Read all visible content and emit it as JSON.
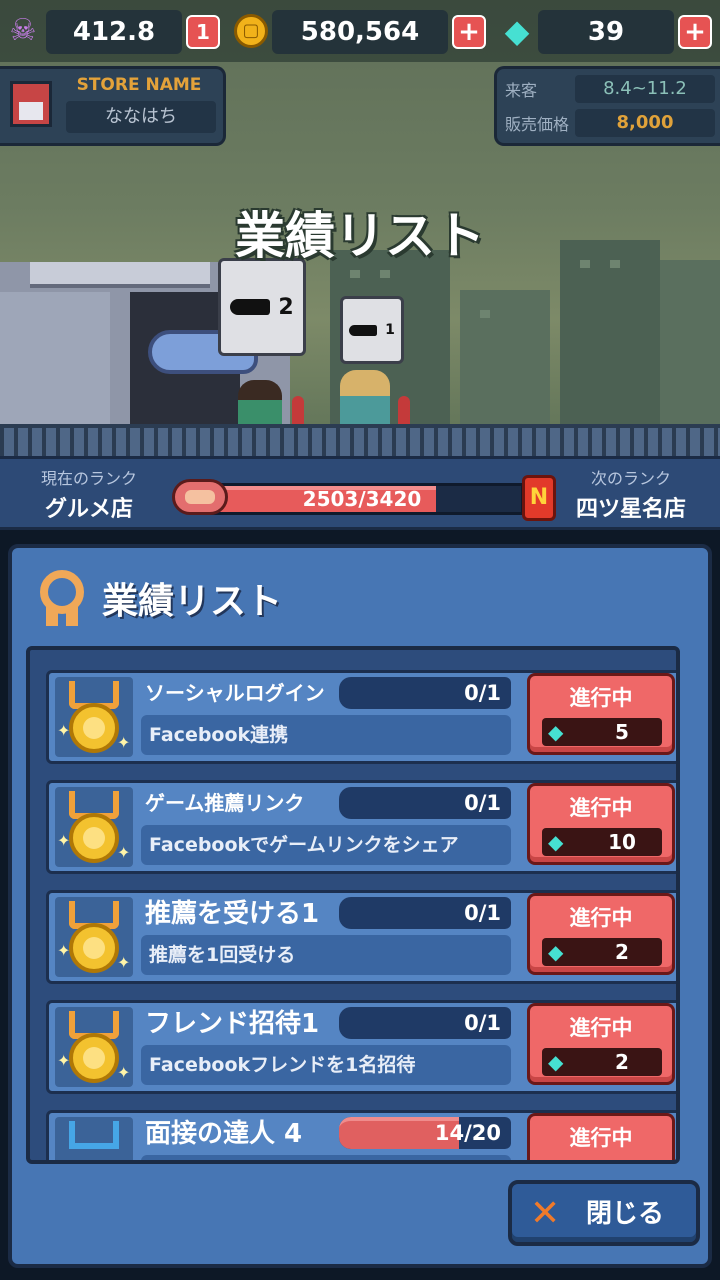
{
  "resources": {
    "skull_value": "412.8",
    "skull_plus_label": "1",
    "coins_value": "580,564",
    "gems_value": "39",
    "plus_glyph": "+"
  },
  "store": {
    "label": "STORE NAME",
    "name": "ななはち"
  },
  "stats": {
    "visitors_label": "来客",
    "visitors_value": "8.4~11.2",
    "price_label": "販売価格",
    "price_value": "8,000"
  },
  "scene": {
    "title": "業績リスト",
    "bubble_large_count": "2",
    "bubble_small_count": "1"
  },
  "rank": {
    "current_label": "現在のランク",
    "current_value": "グルメ店",
    "progress_text": "2503/3420",
    "progress_fraction": 0.732,
    "next_badge": "N",
    "next_label": "次のランク",
    "next_value": "四ツ星名店"
  },
  "panel": {
    "title": "業績リスト",
    "items": [
      {
        "title": "ソーシャルログイン",
        "count": "0/1",
        "progress": 0,
        "desc": "Facebook連携",
        "button": "進行中",
        "reward": "5",
        "icon": "gold-medal-icon"
      },
      {
        "title": "ゲーム推薦リンク",
        "count": "0/1",
        "progress": 0,
        "desc": "Facebookでゲームリンクをシェア",
        "button": "進行中",
        "reward": "10",
        "icon": "gold-medal-icon"
      },
      {
        "title": "推薦を受ける1",
        "count": "0/1",
        "progress": 0,
        "desc": "推薦を1回受ける",
        "button": "進行中",
        "reward": "2",
        "icon": "gold-medal-icon"
      },
      {
        "title": "フレンド招待1",
        "count": "0/1",
        "progress": 0,
        "desc": "Facebookフレンドを1名招待",
        "button": "進行中",
        "reward": "2",
        "icon": "gold-medal-icon"
      },
      {
        "title": "面接の達人 4",
        "count": "14/20",
        "progress": 0.7,
        "desc": "",
        "button": "進行中",
        "reward": "",
        "icon": "blue-medal-icon"
      }
    ],
    "close_label": "閉じる"
  },
  "colors": {
    "accent_red": "#ef6868",
    "panel_blue": "#4776b4",
    "gem_cyan": "#46e0d2",
    "coin_gold": "#f2b21a"
  }
}
